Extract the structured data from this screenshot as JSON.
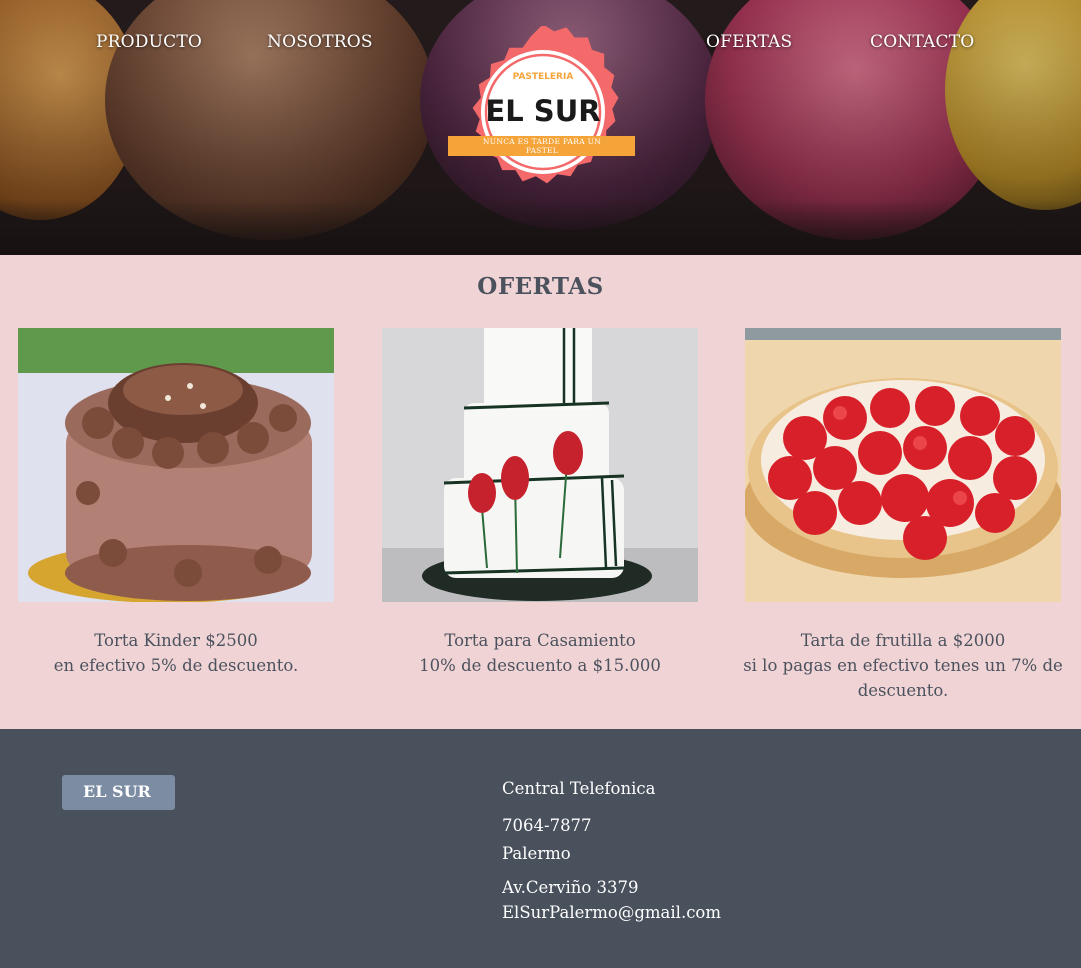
{
  "nav": {
    "items": [
      "PRODUCTO",
      "NOSOTROS",
      "OFERTAS",
      "CONTACTO"
    ]
  },
  "logo": {
    "top_text": "PASTELERIA",
    "name": "EL SUR",
    "tagline": "NUNCA ES TARDE PARA UN PASTEL",
    "colors": {
      "ring": "#f4696a",
      "ribbon": "#f5a43a"
    }
  },
  "offers": {
    "title": "OFERTAS",
    "items": [
      {
        "image": "chocolate-cake",
        "line1": "Torta Kinder $2500",
        "line2": "en efectivo 5% de descuento."
      },
      {
        "image": "wedding-cake",
        "line1": "Torta para Casamiento",
        "line2": "10% de descuento a $15.000"
      },
      {
        "image": "strawberry-tart",
        "line1": "Tarta de frutilla a $2000",
        "line2": "si lo pagas en efectivo tenes un 7% de descuento."
      }
    ]
  },
  "footer": {
    "brand": "EL SUR",
    "heading": "Central Telefonica",
    "phone": "7064-7877",
    "neighborhood": "Palermo",
    "address": "Av.Cerviño 3379",
    "email": "ElSurPalermo@gmail.com"
  },
  "colors": {
    "offers_bg": "#f0d4d5",
    "footer_bg": "#48515c",
    "badge_bg": "#7c8da3",
    "text_dark": "#4b525e"
  }
}
